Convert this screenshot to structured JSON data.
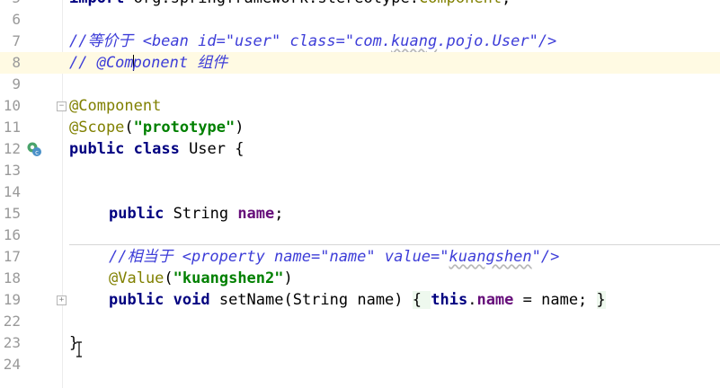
{
  "editor": {
    "lines": [
      {
        "num": "5",
        "segments": [
          {
            "t": "import ",
            "c": "kw"
          },
          {
            "t": "org.springframework.stereotype.",
            "c": "pkg"
          },
          {
            "t": "Component",
            "c": "ann"
          },
          {
            "t": ";",
            "c": "plain"
          }
        ]
      },
      {
        "num": "6",
        "segments": []
      },
      {
        "num": "7",
        "segments": [
          {
            "t": "//等价于 <bean id=\"user\" class=\"com.",
            "c": "cmt"
          },
          {
            "t": "kuang",
            "c": "cmt squig"
          },
          {
            "t": ".pojo.User\"/>",
            "c": "cmt"
          }
        ]
      },
      {
        "num": "8",
        "segments": [
          {
            "t": "// @Com",
            "c": "cmt"
          },
          {
            "t": "",
            "c": "caret"
          },
          {
            "t": "ponent 组件",
            "c": "cmt"
          }
        ],
        "current": true
      },
      {
        "num": "9",
        "segments": []
      },
      {
        "num": "10",
        "segments": [
          {
            "t": "@Component",
            "c": "ann"
          }
        ]
      },
      {
        "num": "11",
        "segments": [
          {
            "t": "@Scope",
            "c": "ann"
          },
          {
            "t": "(",
            "c": "plain"
          },
          {
            "t": "\"prototype\"",
            "c": "str"
          },
          {
            "t": ")",
            "c": "plain"
          }
        ]
      },
      {
        "num": "12",
        "segments": [
          {
            "t": "public class ",
            "c": "kw"
          },
          {
            "t": "User {",
            "c": "plain"
          }
        ]
      },
      {
        "num": "13",
        "segments": []
      },
      {
        "num": "14",
        "segments": []
      },
      {
        "num": "15",
        "indent": true,
        "segments": [
          {
            "t": "public ",
            "c": "kw"
          },
          {
            "t": "String ",
            "c": "plain"
          },
          {
            "t": "name",
            "c": "fld"
          },
          {
            "t": ";",
            "c": "plain"
          }
        ]
      },
      {
        "num": "16",
        "segments": []
      },
      {
        "num": "17",
        "indent": true,
        "segments": [
          {
            "t": "//相当于 <property name=\"name\" value=\"",
            "c": "cmt"
          },
          {
            "t": "kuangshen",
            "c": "cmt squig"
          },
          {
            "t": "\"/>",
            "c": "cmt"
          }
        ]
      },
      {
        "num": "18",
        "indent": true,
        "segments": [
          {
            "t": "@Value",
            "c": "ann"
          },
          {
            "t": "(",
            "c": "plain"
          },
          {
            "t": "\"kuangshen2\"",
            "c": "str"
          },
          {
            "t": ")",
            "c": "plain"
          }
        ]
      },
      {
        "num": "19",
        "indent": true,
        "segments": [
          {
            "t": "public void ",
            "c": "kw"
          },
          {
            "t": "setName(String name) ",
            "c": "plain"
          },
          {
            "t": "{ ",
            "c": "brace-hl"
          },
          {
            "t": "this",
            "c": "kw"
          },
          {
            "t": ".",
            "c": "plain"
          },
          {
            "t": "name",
            "c": "fld"
          },
          {
            "t": " = name; ",
            "c": "plain"
          },
          {
            "t": "}",
            "c": "brace-hl"
          }
        ]
      },
      {
        "num": "22",
        "segments": []
      },
      {
        "num": "23",
        "segments": [
          {
            "t": "}",
            "c": "plain"
          }
        ]
      },
      {
        "num": "24",
        "segments": []
      }
    ]
  },
  "gutter_icons": {
    "class_marker": "class-implementation-icon"
  }
}
